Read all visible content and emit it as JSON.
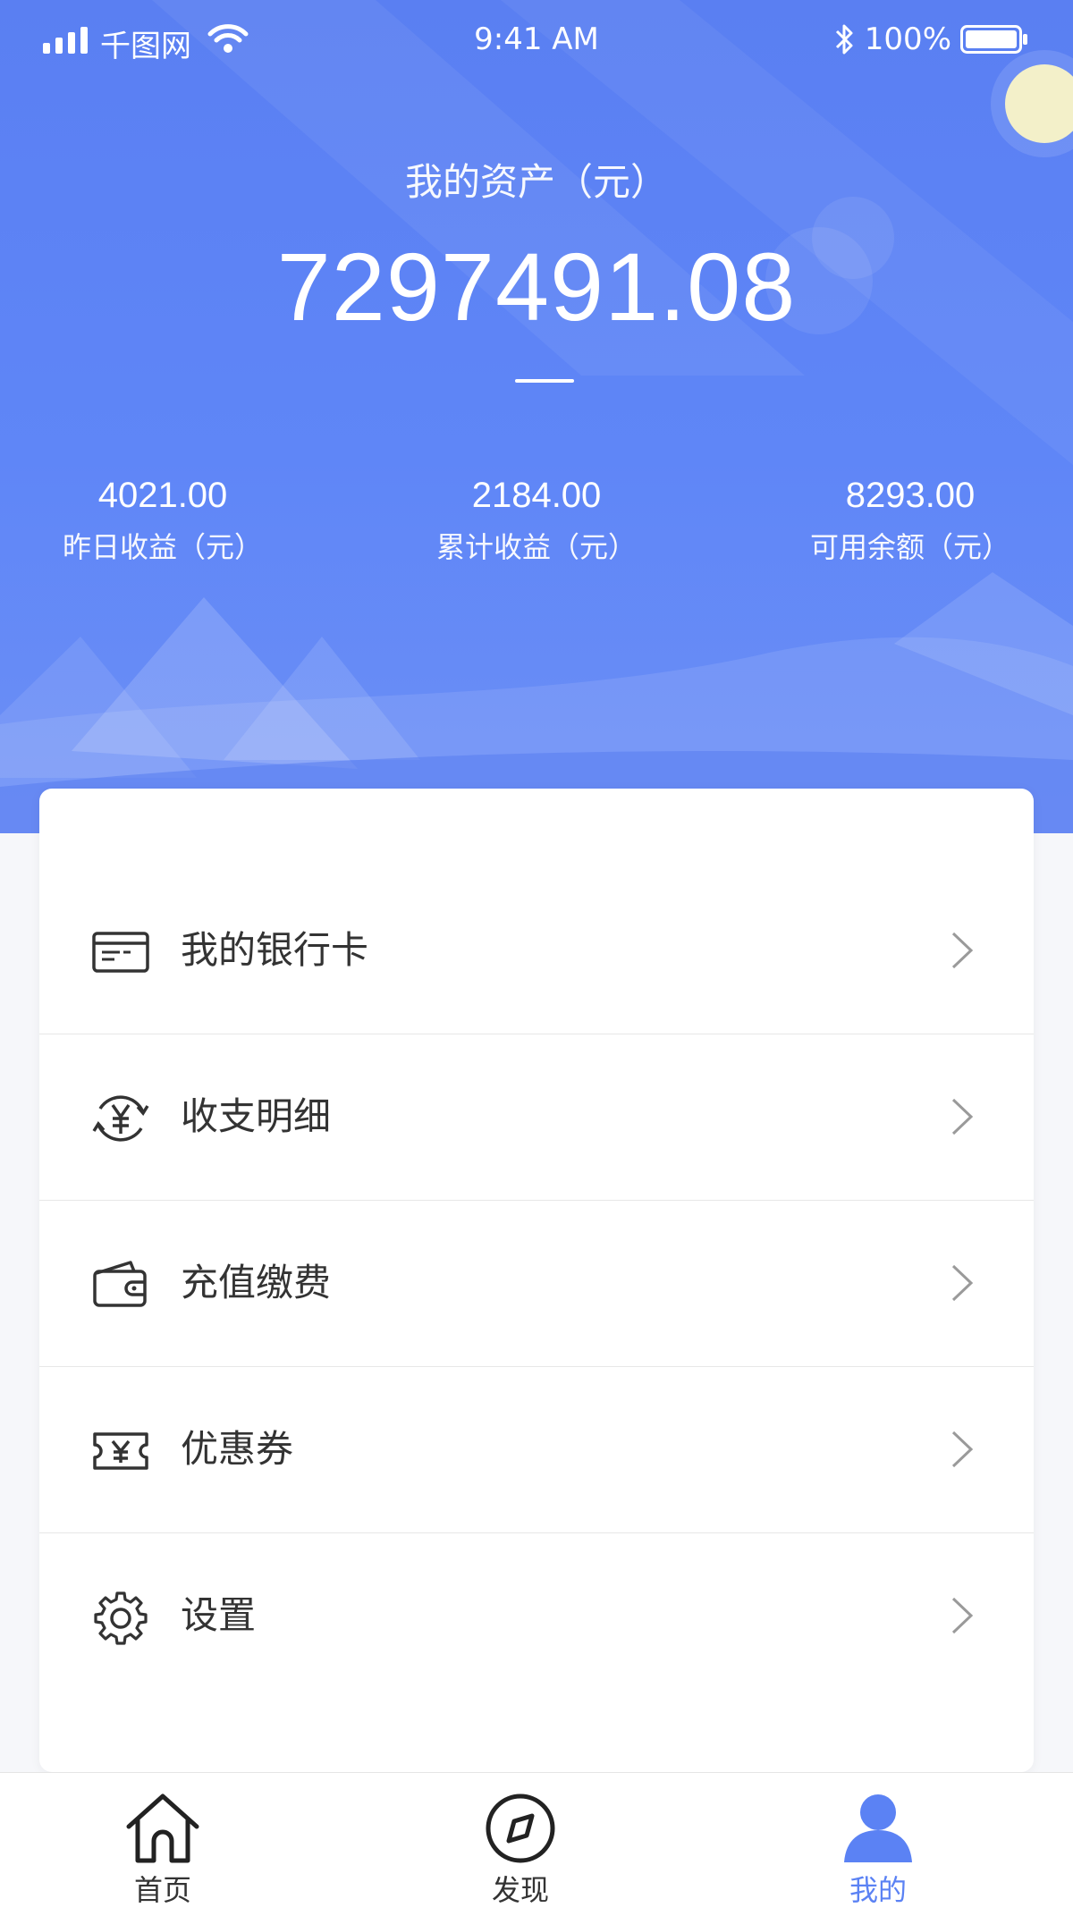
{
  "status_bar": {
    "carrier": "千图网",
    "time": "9:41 AM",
    "battery": "100%"
  },
  "assets": {
    "title": "我的资产（元）",
    "total": "7297491.08"
  },
  "stats": [
    {
      "value": "4021.00",
      "label": "昨日收益（元）"
    },
    {
      "value": "2184.00",
      "label": "累计收益（元）"
    },
    {
      "value": "8293.00",
      "label": "可用余额（元）"
    }
  ],
  "menu": [
    {
      "label": "我的银行卡",
      "icon": "bank-card-icon"
    },
    {
      "label": "收支明细",
      "icon": "yuan-exchange-icon"
    },
    {
      "label": "充值缴费",
      "icon": "wallet-icon"
    },
    {
      "label": "优惠券",
      "icon": "coupon-icon"
    },
    {
      "label": "设置",
      "icon": "gear-icon"
    }
  ],
  "tabbar": {
    "items": [
      {
        "label": "首页",
        "icon": "home-icon"
      },
      {
        "label": "发现",
        "icon": "compass-icon"
      },
      {
        "label": "我的",
        "icon": "user-icon",
        "active": true
      }
    ]
  },
  "colors": {
    "accent": "#5b82f4",
    "header_bg": "#5f86f7"
  }
}
